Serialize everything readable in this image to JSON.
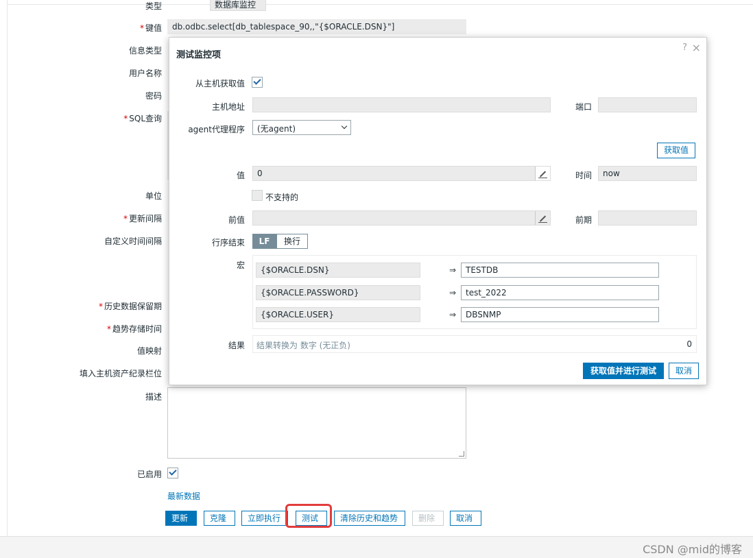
{
  "form": {
    "type_label": "类型",
    "type_value": "数据库监控",
    "key_label": "键值",
    "key_value": "db.odbc.select[db_tablespace_90,,\"{$ORACLE.DSN}\"]",
    "info_type_label": "信息类型",
    "username_label": "用户名称",
    "password_label": "密码",
    "sql_label": "SQL查询",
    "unit_label": "单位",
    "update_interval_label": "更新间隔",
    "custom_interval_label": "自定义时间间隔",
    "history_label": "历史数据保留期",
    "trend_label": "趋势存储时间",
    "value_map_label": "值映射",
    "inventory_label": "填入主机资产纪录栏位",
    "description_label": "描述",
    "enabled_label": "已启用",
    "latest_data_link": "最新数据",
    "buttons": {
      "update": "更新",
      "clone": "克隆",
      "execute_now": "立即执行",
      "test": "测试",
      "clear_history": "清除历史和趋势",
      "delete": "删除",
      "cancel": "取消"
    }
  },
  "modal": {
    "title": "测试监控项",
    "help": "?",
    "close": "×",
    "get_from_host_label": "从主机获取值",
    "host_address_label": "主机地址",
    "port_label": "端口",
    "agent_label": "agent代理程序",
    "agent_value": "(无agent)",
    "get_value_button": "获取值",
    "value_label": "值",
    "value_value": "0",
    "time_label": "时间",
    "time_value": "now",
    "not_supported_label": "不支持的",
    "prev_value_label": "前值",
    "prev_time_label": "前期",
    "eol_label": "行序结束",
    "eol_lf": "LF",
    "eol_crlf": "换行",
    "macros_label": "宏",
    "macros": [
      {
        "name": "{$ORACLE.DSN}",
        "arrow": "⇒",
        "value": "TESTDB"
      },
      {
        "name": "{$ORACLE.PASSWORD}",
        "arrow": "⇒",
        "value": "test_2022"
      },
      {
        "name": "{$ORACLE.USER}",
        "arrow": "⇒",
        "value": "DBSNMP"
      }
    ],
    "result_label": "结果",
    "result_text": "结果转换为 数字 (无正负)",
    "result_value": "0",
    "test_button": "获取值并进行测试",
    "cancel_button": "取消"
  },
  "watermark": "CSDN @mid的博客"
}
